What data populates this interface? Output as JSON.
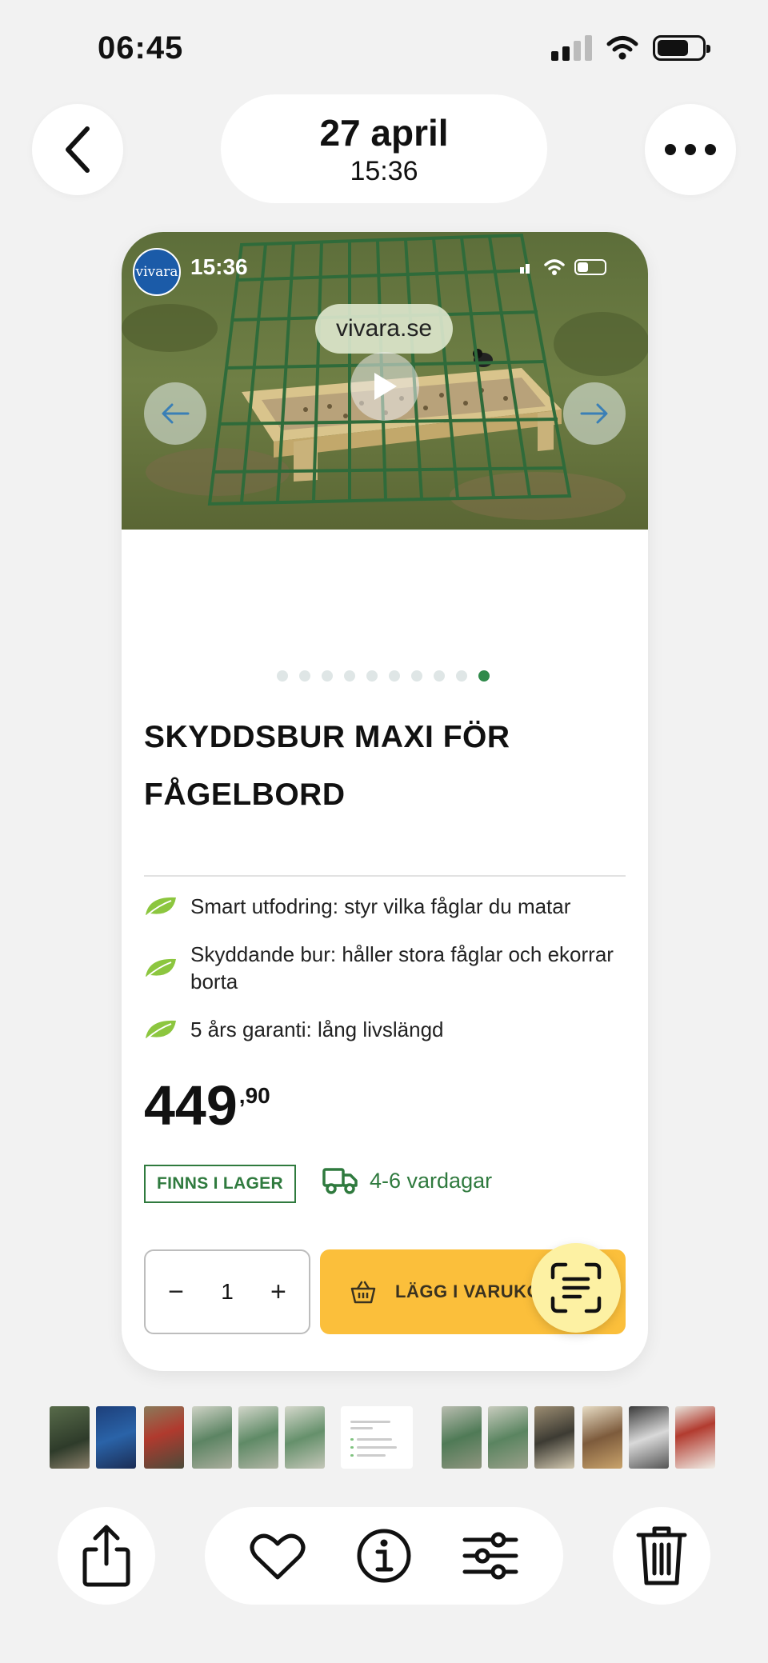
{
  "status_bar": {
    "time": "06:45",
    "icons": [
      "cellular-signal-icon",
      "wifi-icon",
      "battery-icon"
    ]
  },
  "nav": {
    "date": "27 april",
    "time": "15:36",
    "back_icon": "chevron-left-icon",
    "more_icon": "ellipsis-icon"
  },
  "screenshot": {
    "logo_text": "vivara",
    "time": "15:36",
    "domain": "vivara.se",
    "carousel_dots_total": 10,
    "carousel_active_index": 9
  },
  "product": {
    "title_line1": "SKYDDSBUR MAXI FÖR",
    "title_line2": "FÅGELBORD",
    "features": [
      "Smart utfodring: styr vilka fåglar du matar",
      "Skyddande bur: håller stora fåglar och ekorrar borta",
      "5 års garanti: lång livslängd"
    ],
    "price_main": "449",
    "price_decimals": ",90",
    "stock_badge": "FINNS I LAGER",
    "delivery": "4-6 vardagar",
    "quantity": "1",
    "qty_minus": "−",
    "qty_plus": "+",
    "add_to_cart": "LÄGG I VARUKORGEN"
  },
  "colors": {
    "accent_green": "#2f7a3e",
    "cart_yellow": "#fbbf3b",
    "scan_yellow": "#fdf1a3",
    "leaf_green": "#8cc63f"
  },
  "toolbar": {
    "share_icon": "share-icon",
    "favorite_icon": "heart-icon",
    "info_icon": "info-icon",
    "adjust_icon": "sliders-icon",
    "delete_icon": "trash-icon"
  }
}
